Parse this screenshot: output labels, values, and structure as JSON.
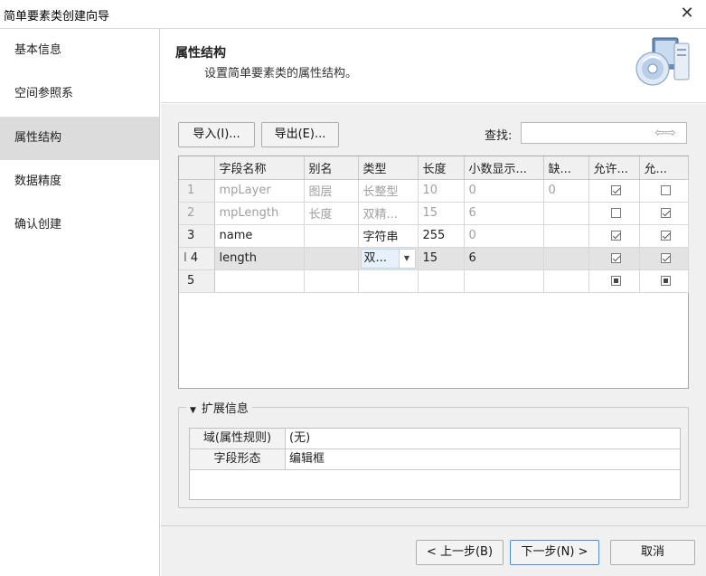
{
  "window": {
    "title": "简单要素类创建向导"
  },
  "sidebar": {
    "items": [
      {
        "label": "基本信息"
      },
      {
        "label": "空间参照系"
      },
      {
        "label": "属性结构"
      },
      {
        "label": "数据精度"
      },
      {
        "label": "确认创建"
      }
    ],
    "active_index": 2
  },
  "header": {
    "title": "属性结构",
    "subtitle": "设置简单要素类的属性结构。"
  },
  "toolbar": {
    "import_label": "导入(I)...",
    "export_label": "导出(E)...",
    "search_label": "查找:",
    "search_value": "",
    "search_arrows": "⇦⇨"
  },
  "table": {
    "columns": [
      "",
      "字段名称",
      "别名",
      "类型",
      "长度",
      "小数显示...",
      "缺...",
      "允许...",
      "允..."
    ],
    "rows": [
      {
        "num": "1",
        "name": "mpLayer",
        "alias": "图层",
        "type": "长整型",
        "length": "10",
        "decimal": "0",
        "default": "0",
        "allow1": "checked",
        "allow2": "unchecked"
      },
      {
        "num": "2",
        "name": "mpLength",
        "alias": "长度",
        "type": "双精...",
        "length": "15",
        "decimal": "6",
        "default": "",
        "allow1": "unchecked",
        "allow2": "checked"
      },
      {
        "num": "3",
        "name": "name",
        "alias": "",
        "type": "字符串",
        "length": "255",
        "decimal": "0",
        "default": "",
        "allow1": "checked",
        "allow2": "checked"
      },
      {
        "num": "4",
        "row_marker": "I",
        "name": "length",
        "alias": "",
        "type": "双...",
        "length": "15",
        "decimal": "6",
        "default": "",
        "allow1": "checked",
        "allow2": "checked"
      },
      {
        "num": "5",
        "name": "",
        "alias": "",
        "type": "",
        "length": "",
        "decimal": "",
        "default": "",
        "allow1": "indeterminate",
        "allow2": "indeterminate"
      }
    ]
  },
  "extended": {
    "title": "扩展信息",
    "rows": [
      {
        "key": "域(属性规则)",
        "value": "(无)"
      },
      {
        "key": "字段形态",
        "value": "编辑框"
      }
    ]
  },
  "footer": {
    "prev_label": "< 上一步(B)",
    "next_label": "下一步(N) >",
    "cancel_label": "取消"
  }
}
